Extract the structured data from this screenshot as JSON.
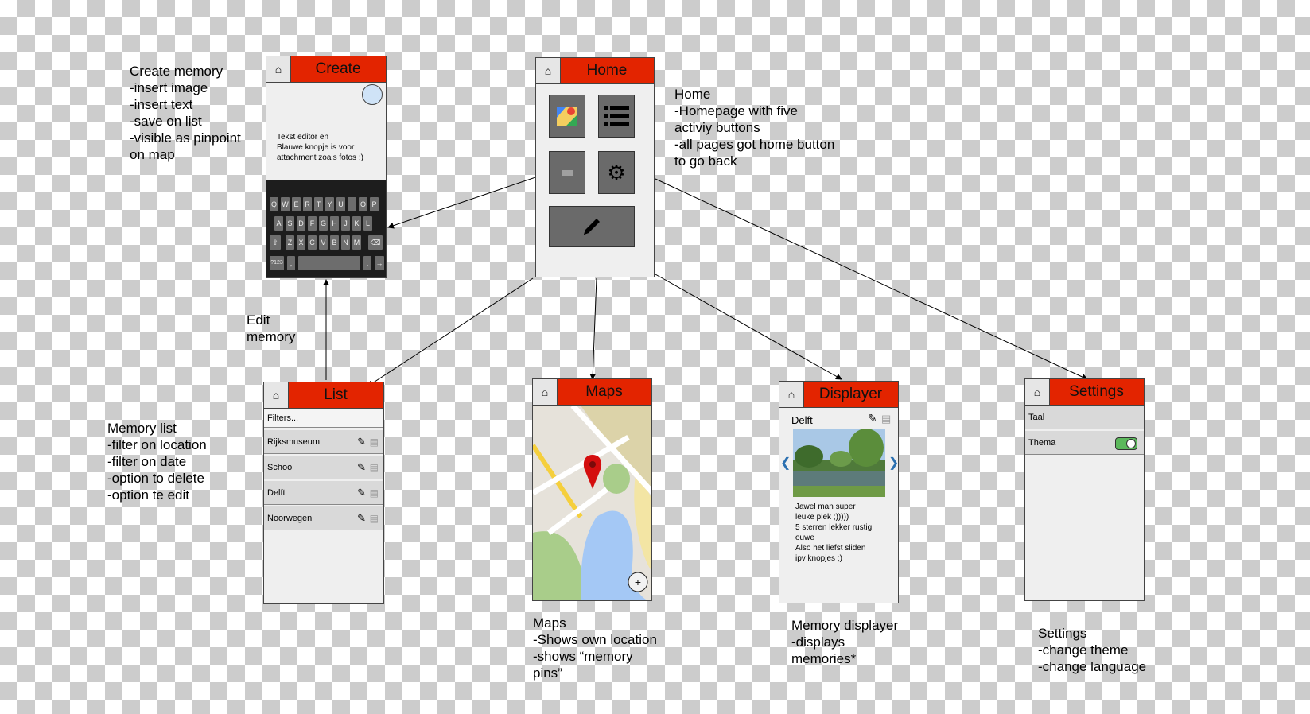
{
  "notes": {
    "create": [
      "Create memory",
      "-insert image",
      "-insert text",
      "-save on list",
      "-visible as pinpoint",
      "on map"
    ],
    "home": [
      "Home",
      "-Homepage with five",
      "activiy buttons",
      "-all pages got home button",
      "to go back"
    ],
    "edit": [
      "Edit",
      "memory"
    ],
    "list": [
      "Memory list",
      "-filter on location",
      "-filter on date",
      "-option to delete",
      "-option te edit"
    ],
    "maps": [
      "Maps",
      "-Shows own location",
      "-shows “memory",
      "pins”"
    ],
    "displayer": [
      "Memory displayer",
      "-displays",
      "memories*"
    ],
    "settings": [
      "Settings",
      "-change theme",
      "-change language"
    ]
  },
  "screens": {
    "create": {
      "title": "Create",
      "editor_text": [
        "Tekst editor en",
        "Blauwe knopje is voor",
        "attachment zoals fotos ;)"
      ],
      "keyboard": {
        "row1": [
          "Q",
          "W",
          "E",
          "R",
          "T",
          "Y",
          "U",
          "I",
          "O",
          "P"
        ],
        "row2": [
          "A",
          "S",
          "D",
          "F",
          "G",
          "H",
          "J",
          "K",
          "L"
        ],
        "row3": [
          "Z",
          "X",
          "C",
          "V",
          "B",
          "N",
          "M"
        ],
        "numkey": "?123"
      }
    },
    "home": {
      "title": "Home"
    },
    "list": {
      "title": "List",
      "filter_placeholder": "Filters...",
      "items": [
        "Rijksmuseum",
        "School",
        "Delft",
        "Noorwegen"
      ]
    },
    "maps": {
      "title": "Maps"
    },
    "displayer": {
      "title": "Displayer",
      "memory_title": "Delft",
      "text": [
        "Jawel man super",
        "leuke plek ;)))))",
        "5 sterren lekker rustig",
        "ouwe",
        "Also het liefst sliden",
        "ipv knopjes ;)"
      ]
    },
    "settings": {
      "title": "Settings",
      "items": [
        "Taal",
        "Thema"
      ],
      "theme_toggle_on": true
    }
  },
  "colors": {
    "header": "#e32400",
    "toggle": "#5cb85c",
    "tile": "#6a6a6a"
  }
}
